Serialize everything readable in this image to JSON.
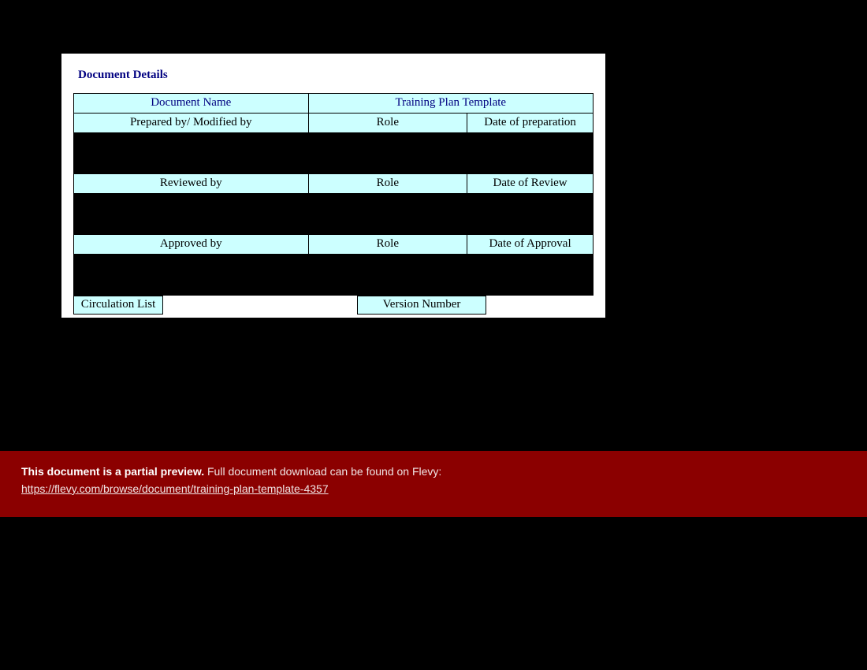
{
  "doc": {
    "section_title": "Document Details",
    "header": {
      "name_label": "Document Name",
      "name_value": "Training Plan Template"
    },
    "rows": [
      {
        "c1": "Prepared by/ Modified by",
        "c2": "Role",
        "c3": "Date of preparation"
      },
      {
        "c1": "Reviewed by",
        "c2": "Role",
        "c3": "Date of Review"
      },
      {
        "c1": "Approved by",
        "c2": "Role",
        "c3": "Date of Approval"
      }
    ],
    "circulation_label": "Circulation List",
    "version_label": "Version Number"
  },
  "footer": {
    "lead": "This document is a partial preview.",
    "rest": "  Full document download can be found on Flevy:",
    "link": "https://flevy.com/browse/document/training-plan-template-4357"
  }
}
